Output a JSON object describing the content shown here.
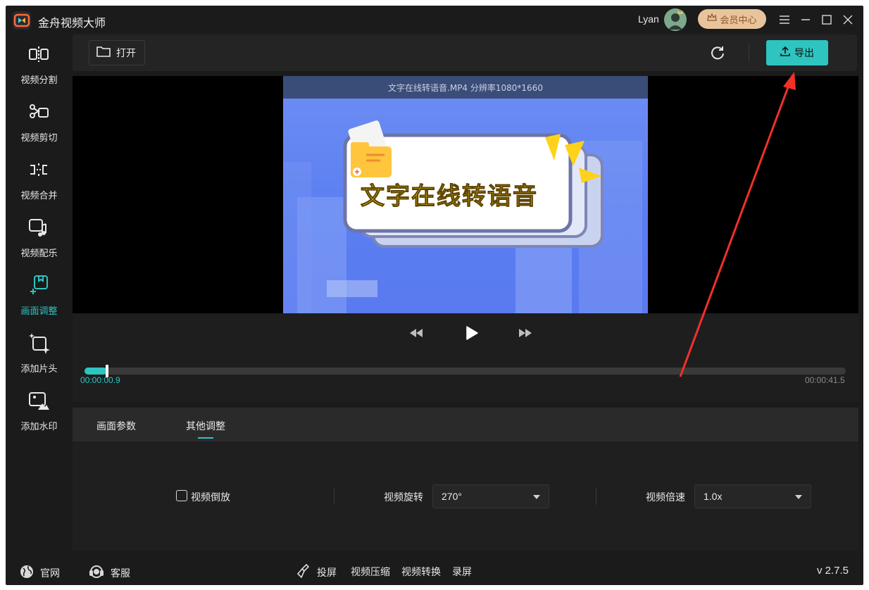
{
  "app": {
    "title": "金舟视频大师",
    "accent": "#2ec4c0"
  },
  "user": {
    "name": "Lyan"
  },
  "header": {
    "vip_label": "会员中心"
  },
  "sidebar": {
    "items": [
      {
        "label": "视频分割",
        "icon": "split-icon"
      },
      {
        "label": "视频剪切",
        "icon": "scissors-icon"
      },
      {
        "label": "视频合并",
        "icon": "merge-icon"
      },
      {
        "label": "视频配乐",
        "icon": "music-icon"
      },
      {
        "label": "画面调整",
        "icon": "adjust-icon",
        "active": true
      },
      {
        "label": "添加片头",
        "icon": "sparkle-frame-icon"
      },
      {
        "label": "添加水印",
        "icon": "watermark-icon"
      }
    ]
  },
  "toolbar": {
    "open_label": "打开",
    "export_label": "导出"
  },
  "preview": {
    "file_info": "文字在线转语音.MP4 分辨率1080*1660",
    "card_title": "文字在线转语音"
  },
  "player": {
    "current_time": "00:00:00.9",
    "total_time": "00:00:41.5",
    "progress": 0.022
  },
  "panel": {
    "tabs": [
      "画面参数",
      "其他调整"
    ],
    "active_tab": 1,
    "reverse_label": "视频倒放",
    "reverse_checked": false,
    "rotate_label": "视频旋转",
    "rotate_value": "270°",
    "speed_label": "视频倍速",
    "speed_value": "1.0x"
  },
  "footer": {
    "website": "官网",
    "support": "客服",
    "links": [
      "投屏",
      "视频压缩",
      "视频转换",
      "录屏"
    ],
    "version": "v 2.7.5"
  }
}
